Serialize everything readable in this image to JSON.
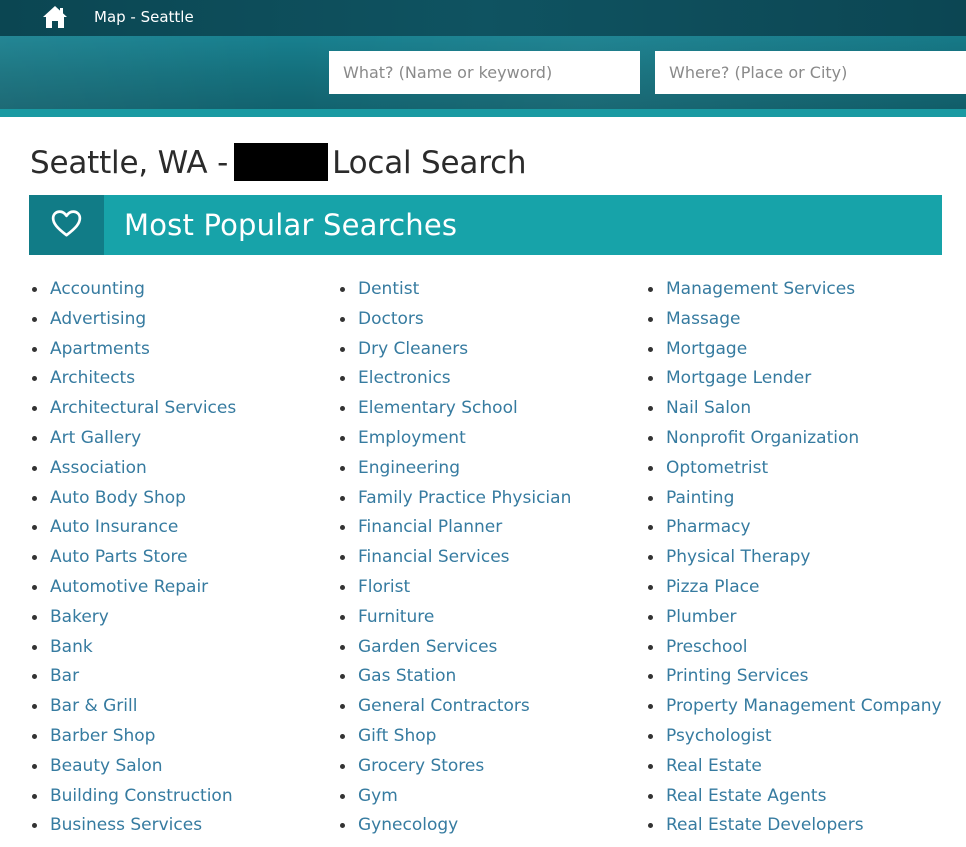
{
  "nav": {
    "home_icon": "home-icon",
    "breadcrumb": "Map - Seattle"
  },
  "search": {
    "what_placeholder": "What? (Name or keyword)",
    "where_placeholder": "Where? (Place or City)"
  },
  "page": {
    "title_prefix": "Seattle, WA -",
    "title_suffix": "Local Search"
  },
  "section": {
    "icon": "heart-icon",
    "title": "Most Popular Searches"
  },
  "colors": {
    "topbar": "#0f5361",
    "section_header": "#17a3a9",
    "section_icon_box": "#117c87",
    "link": "#367ba0"
  },
  "columns": [
    [
      "Accounting",
      "Advertising",
      "Apartments",
      "Architects",
      "Architectural Services",
      "Art Gallery",
      "Association",
      "Auto Body Shop",
      "Auto Insurance",
      "Auto Parts Store",
      "Automotive Repair",
      "Bakery",
      "Bank",
      "Bar",
      "Bar & Grill",
      "Barber Shop",
      "Beauty Salon",
      "Building Construction",
      "Business Services"
    ],
    [
      "Dentist",
      "Doctors",
      "Dry Cleaners",
      "Electronics",
      "Elementary School",
      "Employment",
      "Engineering",
      "Family Practice Physician",
      "Financial Planner",
      "Financial Services",
      "Florist",
      "Furniture",
      "Garden Services",
      "Gas Station",
      "General Contractors",
      "Gift Shop",
      "Grocery Stores",
      "Gym",
      "Gynecology"
    ],
    [
      "Management Services",
      "Massage",
      "Mortgage",
      "Mortgage Lender",
      "Nail Salon",
      "Nonprofit Organization",
      "Optometrist",
      "Painting",
      "Pharmacy",
      "Physical Therapy",
      "Pizza Place",
      "Plumber",
      "Preschool",
      "Printing Services",
      "Property Management Company",
      "Psychologist",
      "Real Estate",
      "Real Estate Agents",
      "Real Estate Developers"
    ]
  ]
}
